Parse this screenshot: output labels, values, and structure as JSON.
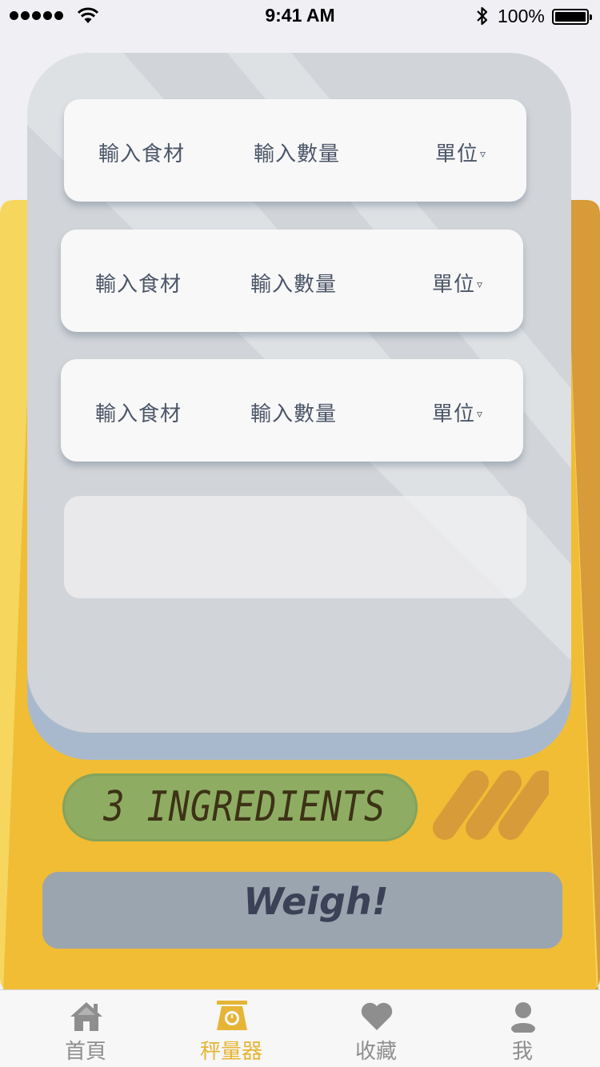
{
  "status_bar": {
    "time": "9:41 AM",
    "battery_percent": "100%",
    "signal_bars": 5,
    "wifi_icon": "wifi-icon",
    "bluetooth_icon": "bluetooth-icon"
  },
  "ingredients": [
    {
      "name_placeholder": "輸入食材",
      "quantity_placeholder": "輸入數量",
      "unit_label": "單位",
      "unit_caret": "▿"
    },
    {
      "name_placeholder": "輸入食材",
      "quantity_placeholder": "輸入數量",
      "unit_label": "單位",
      "unit_caret": "▿"
    },
    {
      "name_placeholder": "輸入食材",
      "quantity_placeholder": "輸入數量",
      "unit_label": "單位",
      "unit_caret": "▿"
    }
  ],
  "display": {
    "text": "3 INGREDIENTS"
  },
  "weigh_button": {
    "label": "Weigh!"
  },
  "tab_bar": {
    "tabs": [
      {
        "label": "首頁",
        "icon": "home-icon",
        "active": false
      },
      {
        "label": "秤量器",
        "icon": "scale-icon",
        "active": true
      },
      {
        "label": "收藏",
        "icon": "heart-icon",
        "active": false
      },
      {
        "label": "我",
        "icon": "person-icon",
        "active": false
      }
    ]
  },
  "colors": {
    "scale_yellow": "#f0bd35",
    "scale_light": "#f7d65d",
    "scale_dark": "#d89b39",
    "tray": "#d1d4d8",
    "tray_shadow": "#a9b9cd",
    "display_green": "#8ead63",
    "button_gray": "#9aa5af",
    "active_tab": "#e6b536",
    "inactive_tab": "#8e8e8e"
  }
}
